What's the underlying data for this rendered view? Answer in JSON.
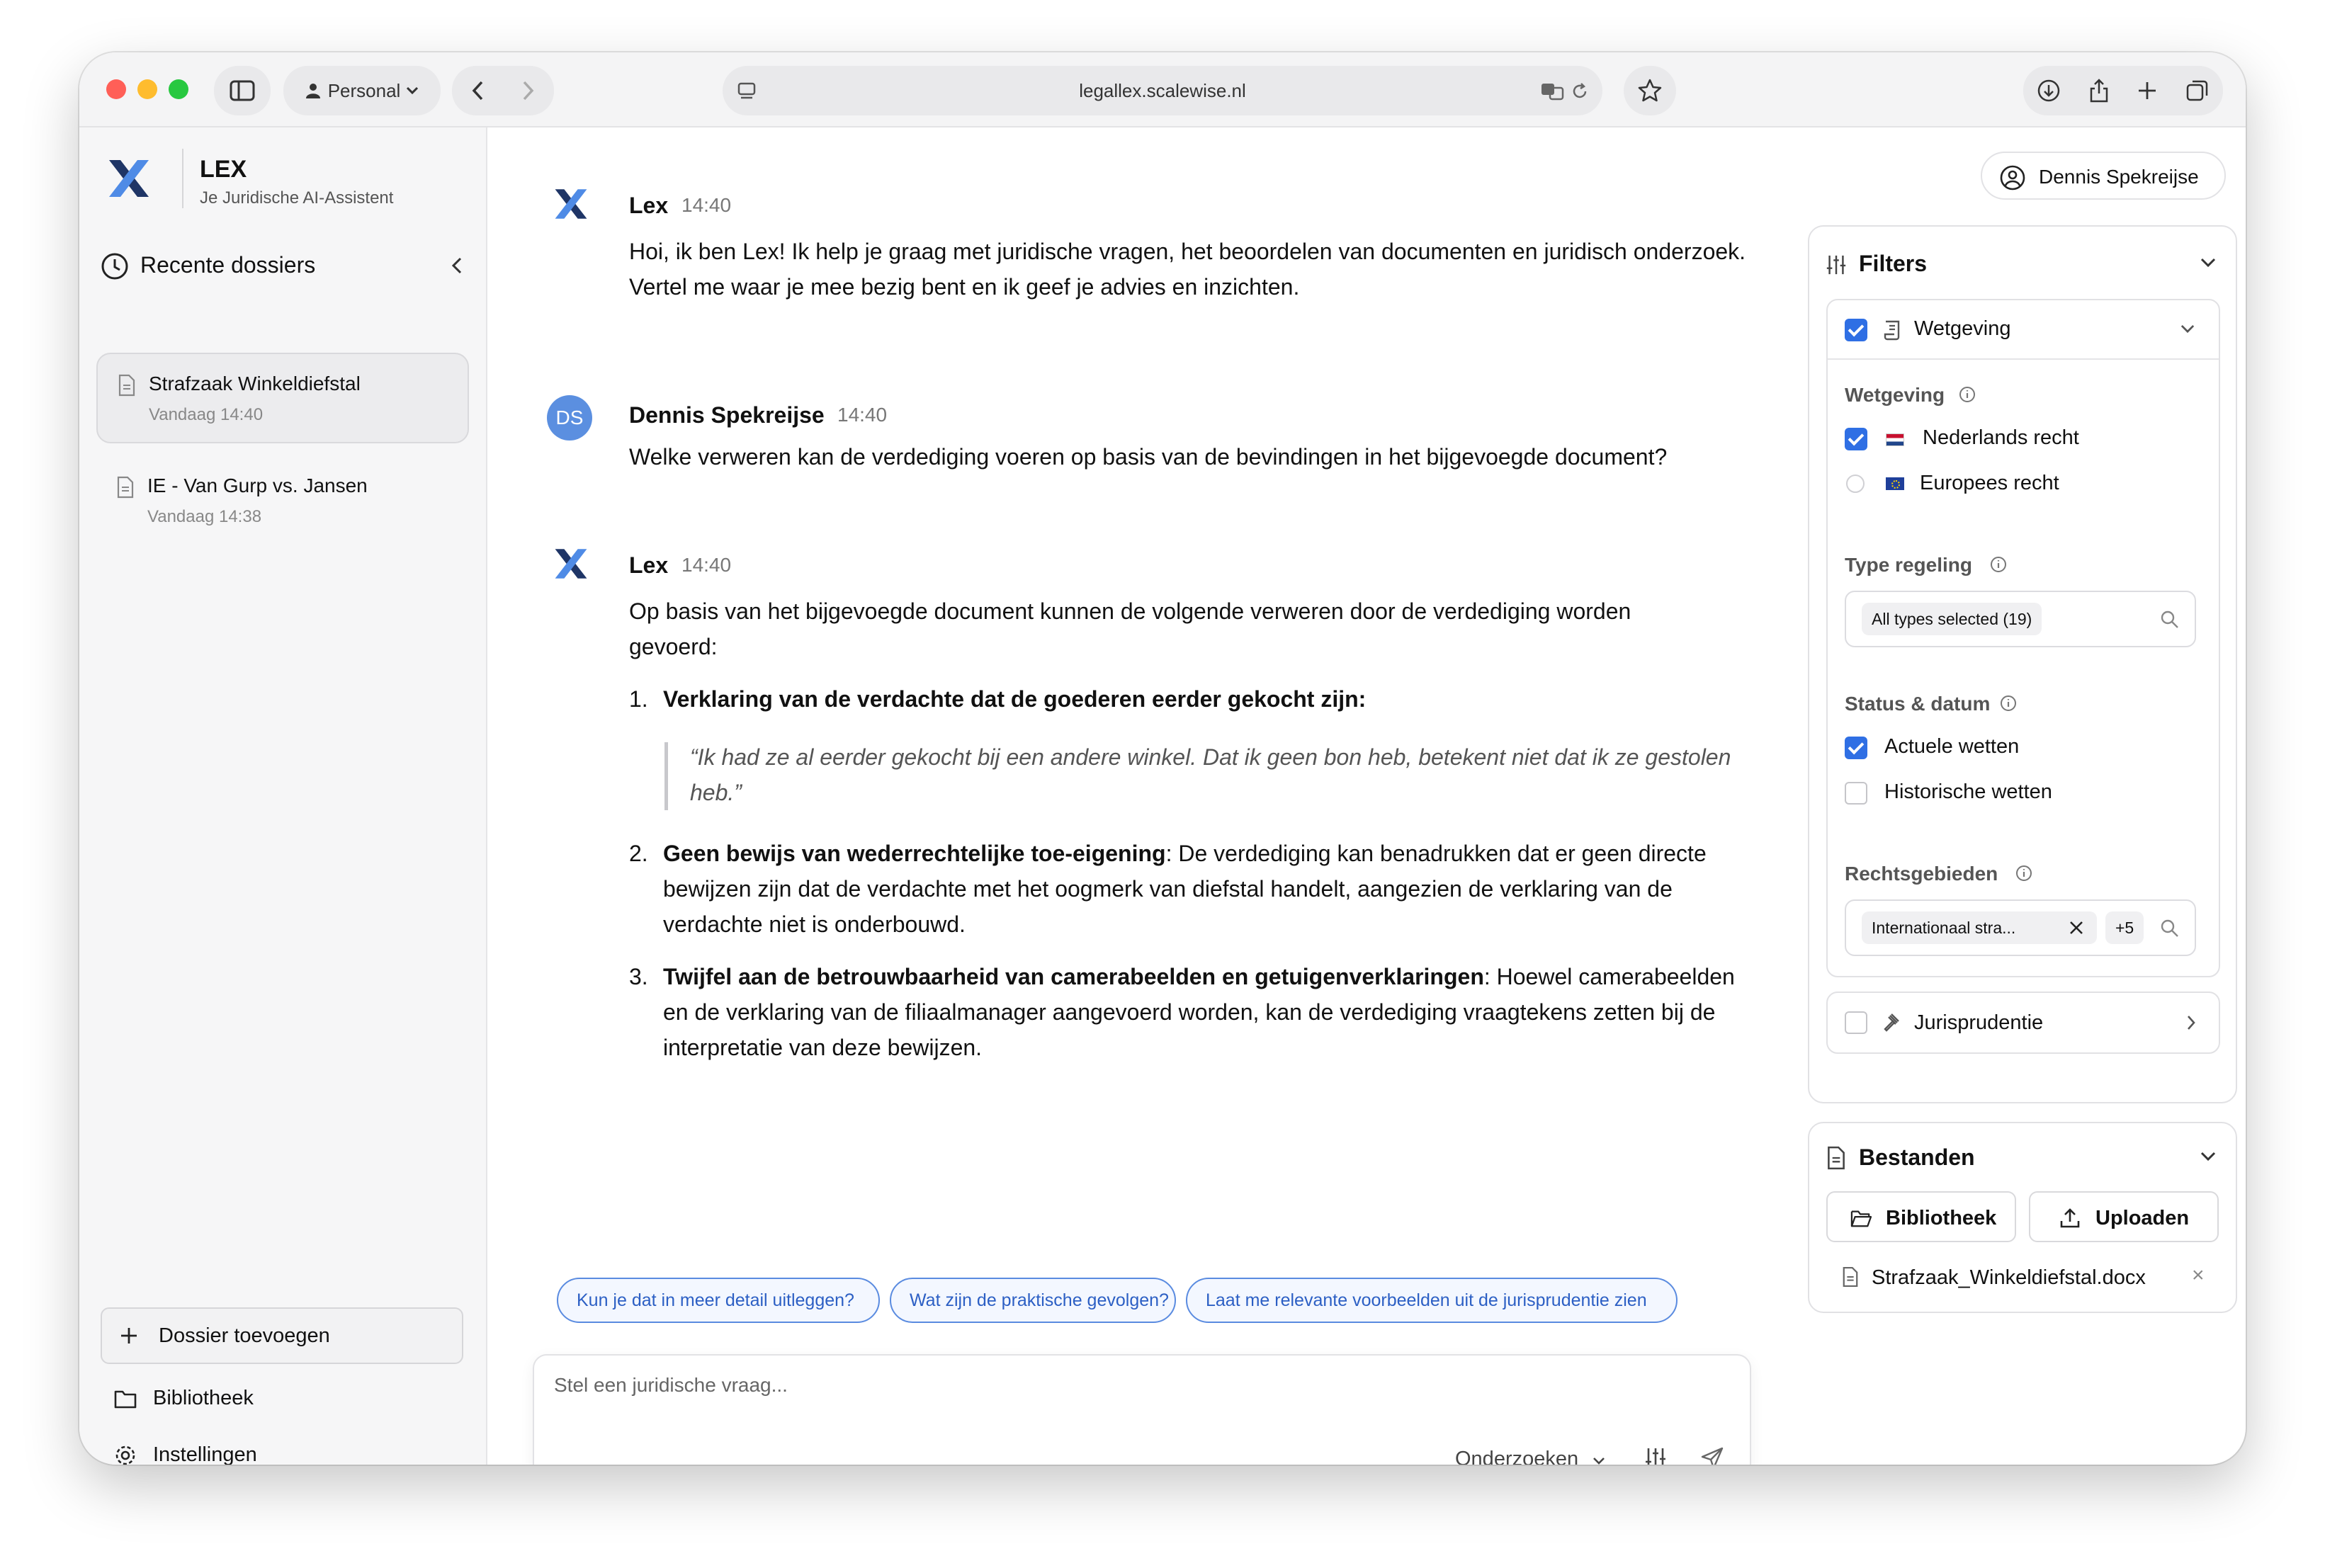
{
  "browser": {
    "profile_label": "Personal",
    "url": "legallex.scalewise.nl"
  },
  "brand": {
    "title": "LEX",
    "subtitle": "Je Juridische AI-Assistent"
  },
  "sidebar": {
    "recent_title": "Recente dossiers",
    "dossiers": [
      {
        "title": "Strafzaak Winkeldiefstal",
        "date": "Vandaag 14:40"
      },
      {
        "title": "IE - Van Gurp vs. Jansen",
        "date": "Vandaag 14:38"
      }
    ],
    "add_dossier_label": "Dossier toevoegen",
    "library_label": "Bibliotheek",
    "settings_label": "Instellingen"
  },
  "chat": {
    "messages": [
      {
        "author": "Lex",
        "time": "14:40",
        "text": "Hoi, ik ben Lex! Ik help je graag met juridische vragen, het beoordelen van documenten en juridisch onderzoek. Vertel me waar je mee bezig bent en ik geef je advies en inzichten."
      },
      {
        "author": "Dennis Spekreijse",
        "initials": "DS",
        "time": "14:40",
        "text": "Welke verweren kan de verdediging voeren op basis van de bevindingen in het bijgevoegde document?"
      },
      {
        "author": "Lex",
        "time": "14:40",
        "intro": "Op basis van het bijgevoegde document kunnen de volgende verweren door de verdediging worden gevoerd:",
        "items": [
          {
            "num": "1.",
            "bold": "Verklaring van de verdachte dat de goederen eerder gekocht zijn:",
            "rest": "",
            "quote": "“Ik had ze al eerder gekocht bij een andere winkel. Dat ik geen bon heb, betekent niet dat ik ze gestolen heb.”"
          },
          {
            "num": "2.",
            "bold": "Geen bewijs van wederrechtelijke toe-eigening",
            "rest": ": De verdediging kan benadrukken dat er geen directe bewijzen zijn dat de verdachte met het oogmerk van diefstal handelt, aangezien de verklaring van de verdachte niet is onderbouwd."
          },
          {
            "num": "3.",
            "bold": "Twijfel aan de betrouwbaarheid van camerabeelden en getuigenverklaringen",
            "rest": ": Hoewel camerabeelden en de verklaring van de filiaalmanager aangevoerd worden, kan de verdediging vraagtekens zetten bij de interpretatie van deze bewijzen."
          }
        ]
      }
    ],
    "suggestions": [
      "Kun je dat in meer detail uitleggen?",
      "Wat zijn de praktische gevolgen?",
      "Laat me relevante voorbeelden uit de jurisprudentie zien"
    ],
    "composer_placeholder": "Stel een juridische vraag...",
    "mode_label": "Onderzoeken"
  },
  "user": {
    "name": "Dennis Spekreijse"
  },
  "filters": {
    "title": "Filters",
    "wetgeving_group": "Wetgeving",
    "wetgeving_label": "Wetgeving",
    "nl_label": "Nederlands recht",
    "eu_label": "Europees recht",
    "type_label": "Type regeling",
    "type_tag": "All types selected (19)",
    "status_label": "Status & datum",
    "actual_label": "Actuele wetten",
    "historic_label": "Historische wetten",
    "rechts_label": "Rechtsgebieden",
    "rechts_tag": "Internationaal stra...",
    "rechts_more": "+5",
    "juris_label": "Jurisprudentie"
  },
  "files": {
    "title": "Bestanden",
    "library_btn": "Bibliotheek",
    "upload_btn": "Uploaden",
    "file_name": "Strafzaak_Winkeldiefstal.docx",
    "remove_glyph": "×"
  },
  "colors": {
    "accent": "#2f6fe4",
    "avatar": "#5b8fe0",
    "logo_dark": "#1f3566",
    "logo_light": "#4f8be6"
  }
}
